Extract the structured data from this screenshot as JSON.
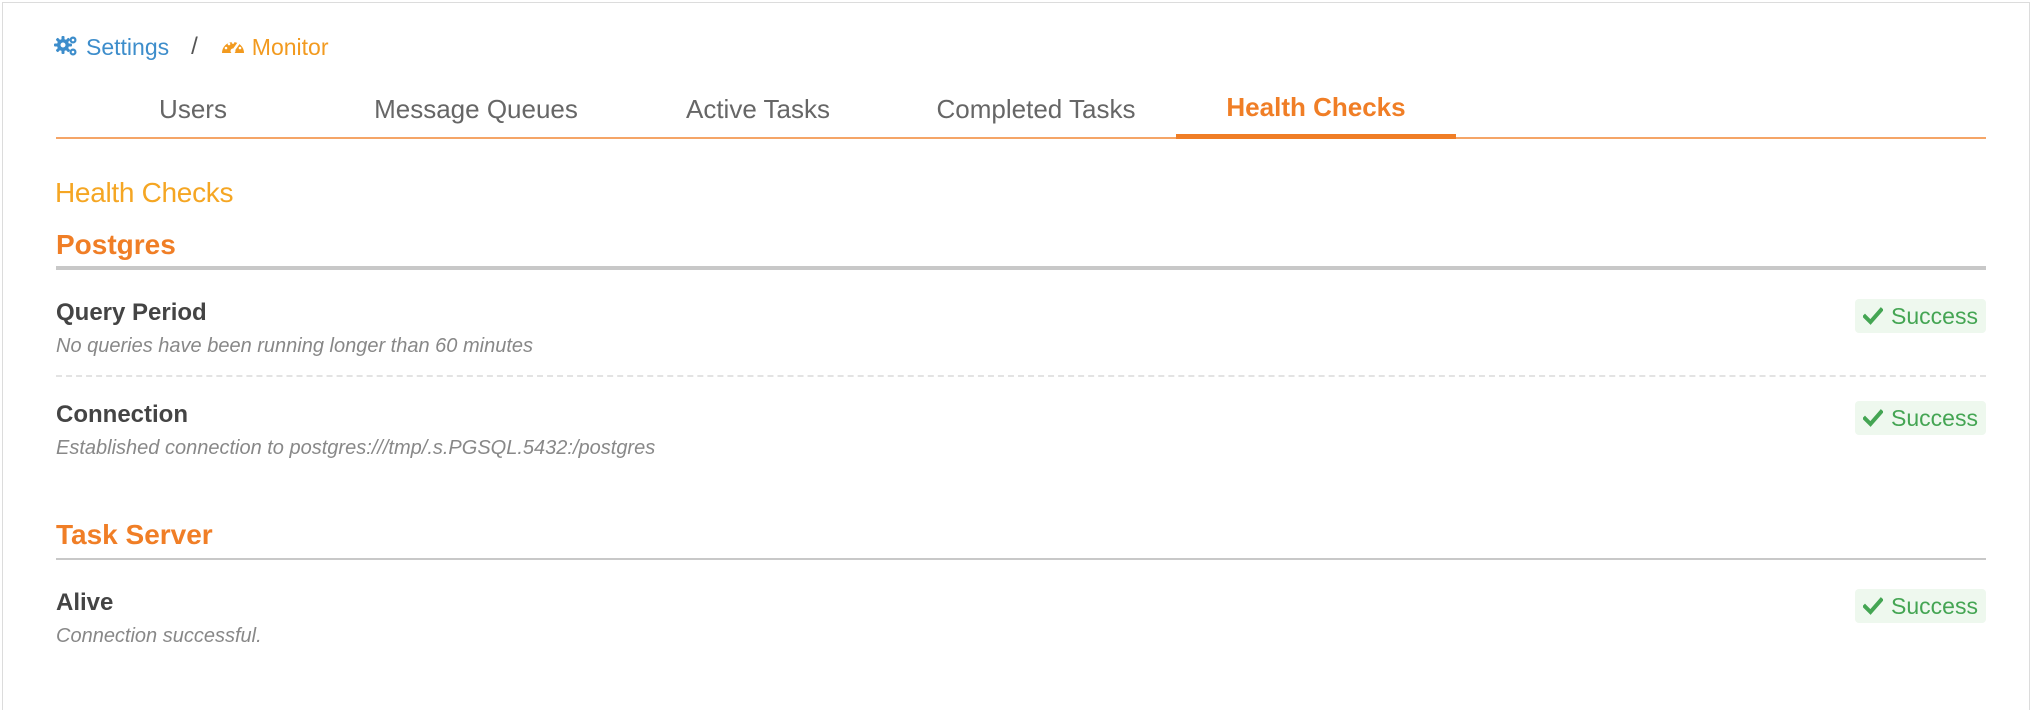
{
  "breadcrumb": {
    "settings_label": "Settings",
    "separator": "/",
    "monitor_label": "Monitor"
  },
  "tabs": [
    {
      "label": "Users",
      "active": false
    },
    {
      "label": "Message Queues",
      "active": false
    },
    {
      "label": "Active Tasks",
      "active": false
    },
    {
      "label": "Completed Tasks",
      "active": false
    },
    {
      "label": "Health Checks",
      "active": true
    }
  ],
  "page_title": "Health Checks",
  "sections": [
    {
      "title": "Postgres",
      "checks": [
        {
          "title": "Query Period",
          "description": "No queries have been running longer than 60 minutes",
          "status": "Success"
        },
        {
          "title": "Connection",
          "description": "Established connection to postgres:///tmp/.s.PGSQL.5432:/postgres",
          "status": "Success"
        }
      ]
    },
    {
      "title": "Task Server",
      "checks": [
        {
          "title": "Alive",
          "description": "Connection successful.",
          "status": "Success"
        }
      ]
    }
  ],
  "colors": {
    "accent": "#f07e26",
    "link": "#3d8dcb",
    "success": "#44a553"
  }
}
